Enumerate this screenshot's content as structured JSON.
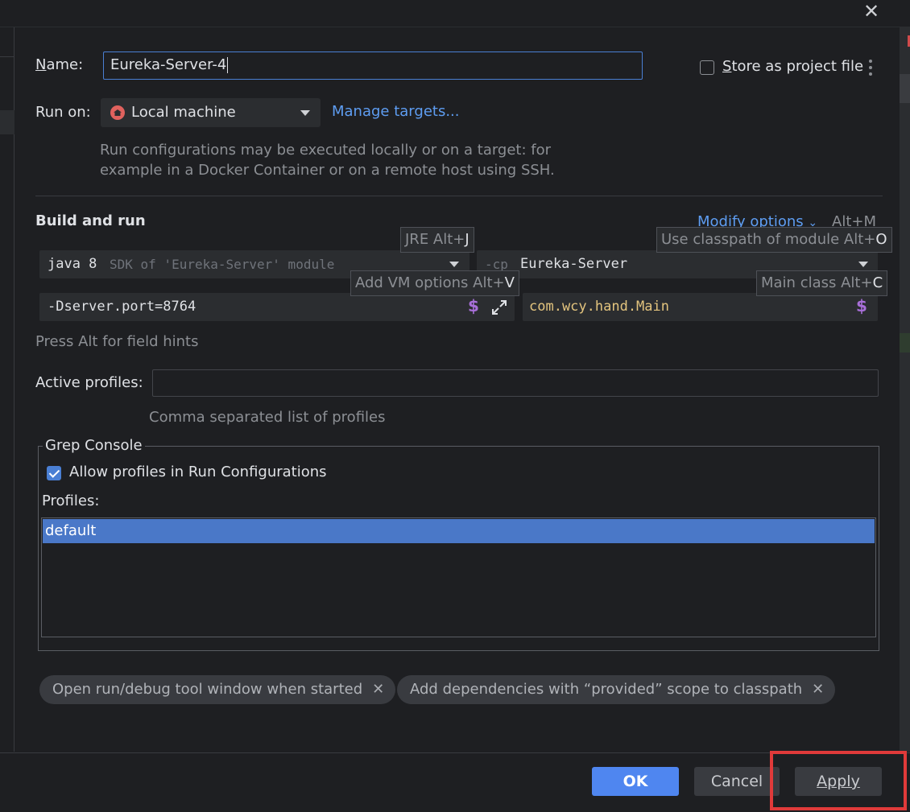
{
  "name_field": {
    "label": "Name:",
    "value": "Eureka-Server-4"
  },
  "store_option": {
    "label": "Store as project file",
    "checked": false
  },
  "run_on": {
    "label": "Run on:",
    "selected": "Local machine",
    "manage_link": "Manage targets...",
    "hint_line1": "Run configurations may be executed locally or on a target: for",
    "hint_line2": "example in a Docker Container or on a remote host using SSH."
  },
  "build_run": {
    "heading": "Build and run",
    "modify_options": "Modify options",
    "modify_shortcut": "Alt+M",
    "jre_tooltip": "JRE Alt+",
    "jre_key": "J",
    "classpath_tooltip": "Use classpath of module Alt+",
    "classpath_key": "O",
    "vm_tooltip": "Add VM options Alt+",
    "vm_key": "V",
    "mainclass_tooltip": "Main class Alt+",
    "mainclass_key": "C",
    "jre_value": "java 8",
    "jre_hint": "SDK of 'Eureka-Server' module",
    "cp_prefix": "-cp",
    "cp_value": "Eureka-Server",
    "vm_value": "-Dserver.port=8764",
    "main_class": "com.wcy.hand.Main",
    "dollar": "$",
    "field_hint": "Press Alt for field hints"
  },
  "profiles": {
    "label": "Active profiles:",
    "value": "",
    "hint": "Comma separated list of profiles"
  },
  "grep_console": {
    "title": "Grep Console",
    "allow_label": "Allow profiles in Run Configurations",
    "allow_checked": true,
    "profiles_label": "Profiles:",
    "items": [
      "default"
    ]
  },
  "chips": [
    {
      "label": "Open run/debug tool window when started"
    },
    {
      "label": "Add dependencies with “provided” scope to classpath"
    }
  ],
  "footer": {
    "ok": "OK",
    "cancel": "Cancel",
    "apply": "Apply"
  },
  "colors": {
    "accent": "#4f86f0",
    "link": "#5e9df2",
    "highlight": "#e03a3a",
    "selection": "#4a78c8"
  }
}
